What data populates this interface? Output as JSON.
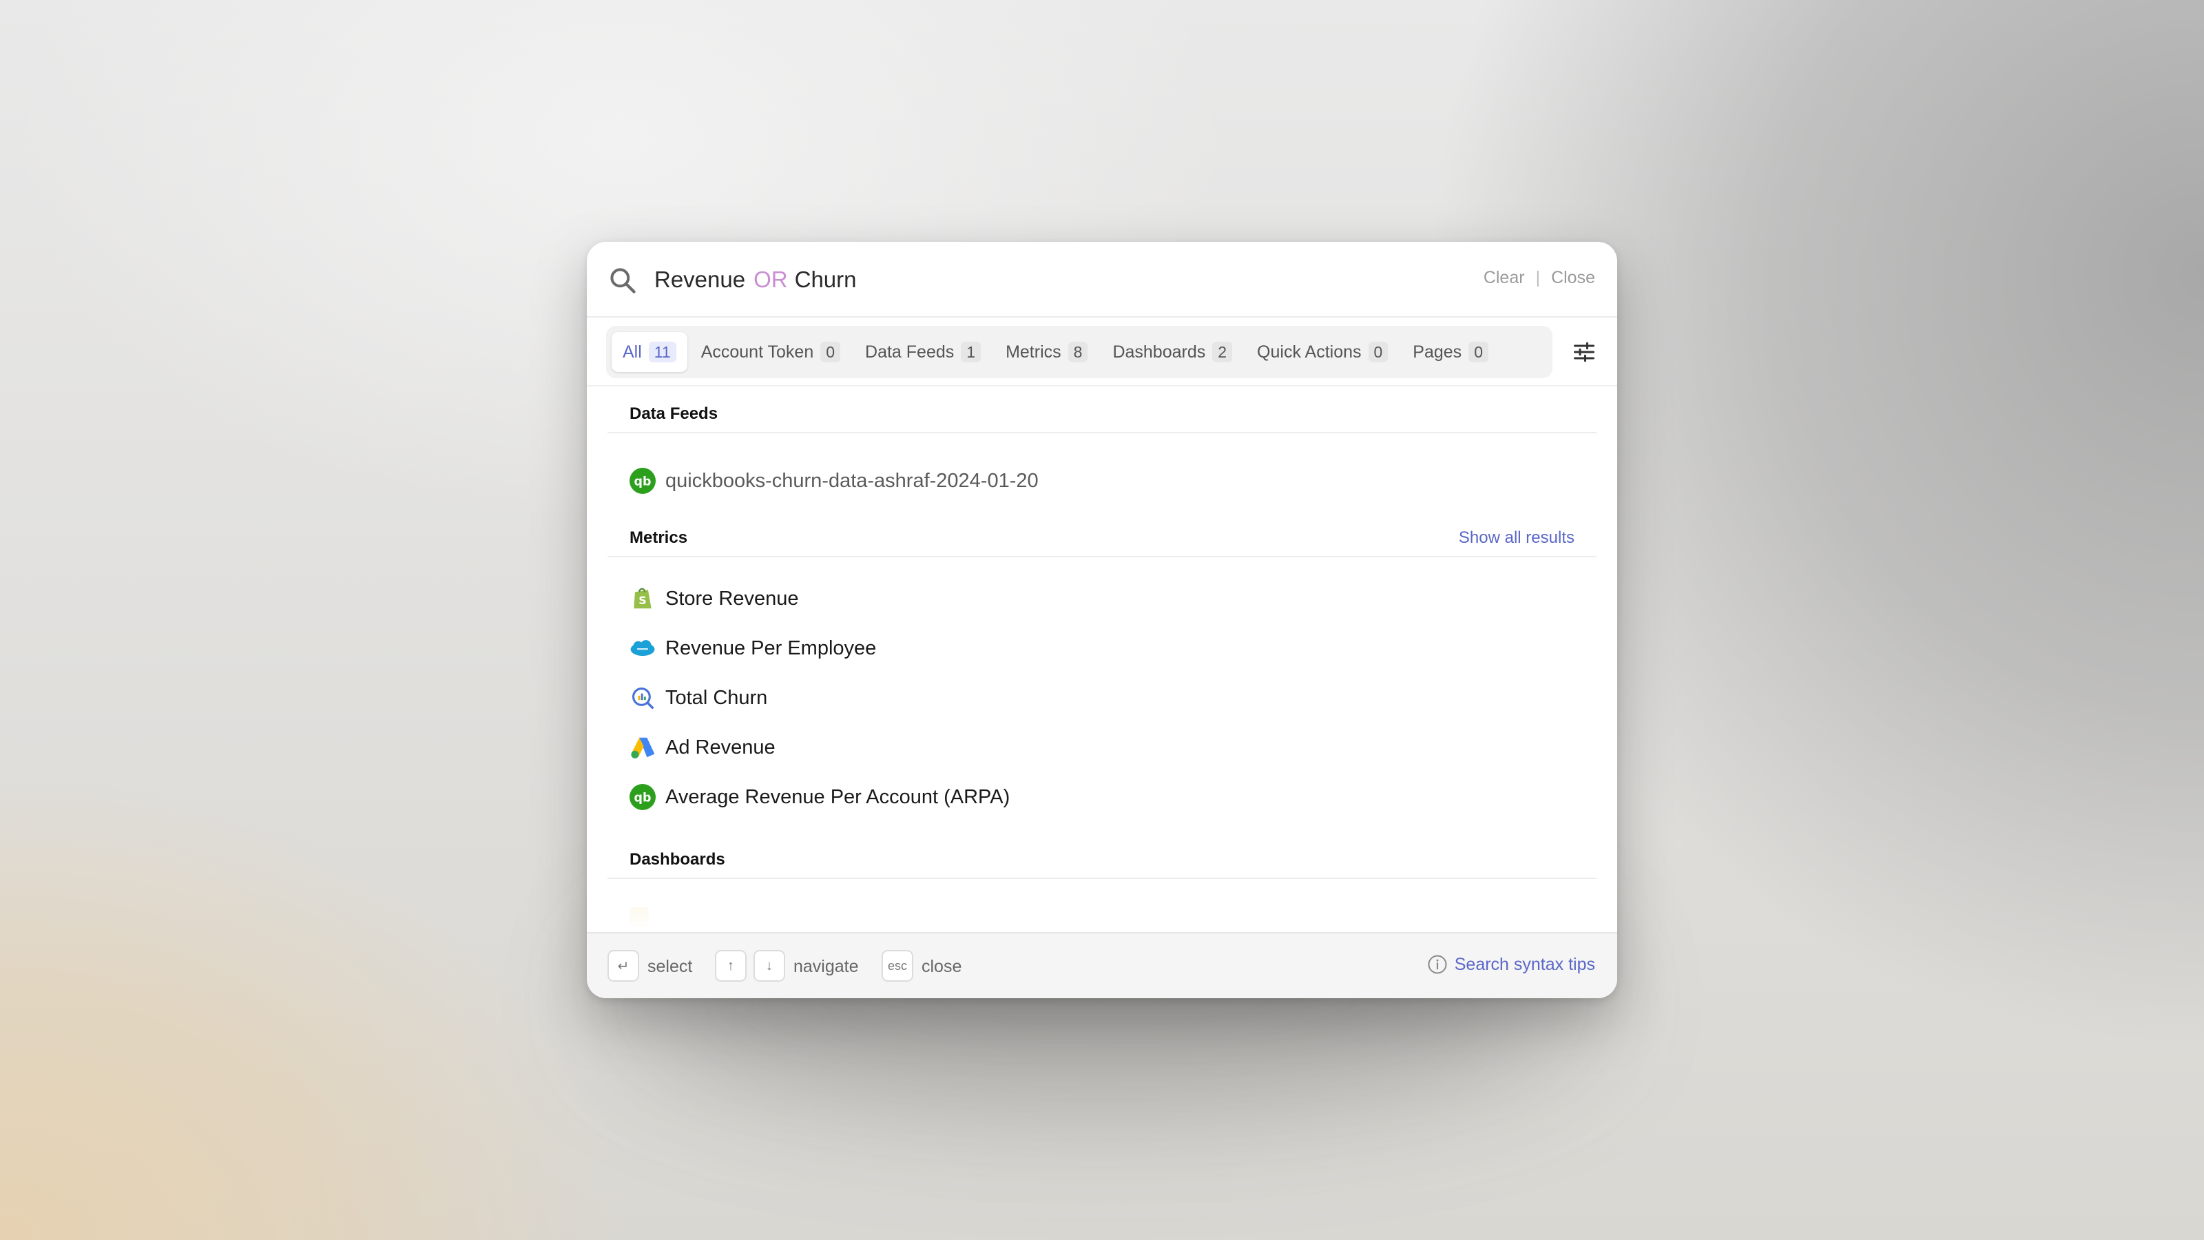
{
  "search": {
    "term1": "Revenue",
    "operator": "OR",
    "term2": "Churn",
    "clear_label": "Clear",
    "close_label": "Close"
  },
  "tabs": [
    {
      "label": "All",
      "count": "11",
      "active": true
    },
    {
      "label": "Account Token",
      "count": "0"
    },
    {
      "label": "Data Feeds",
      "count": "1"
    },
    {
      "label": "Metrics",
      "count": "8"
    },
    {
      "label": "Dashboards",
      "count": "2"
    },
    {
      "label": "Quick Actions",
      "count": "0"
    },
    {
      "label": "Pages",
      "count": "0"
    }
  ],
  "sections": {
    "data_feeds": {
      "title": "Data Feeds",
      "items": [
        {
          "label": "quickbooks-churn-data-ashraf-2024-01-20",
          "icon": "quickbooks-icon"
        }
      ]
    },
    "metrics": {
      "title": "Metrics",
      "show_all_label": "Show all results",
      "items": [
        {
          "label": "Store Revenue",
          "icon": "shopify-icon"
        },
        {
          "label": "Revenue Per Employee",
          "icon": "salesforce-icon"
        },
        {
          "label": "Total Churn",
          "icon": "analytics-search-icon"
        },
        {
          "label": "Ad Revenue",
          "icon": "google-ads-icon"
        },
        {
          "label": "Average Revenue Per Account (ARPA)",
          "icon": "quickbooks-icon"
        }
      ]
    },
    "dashboards": {
      "title": "Dashboards"
    }
  },
  "footer": {
    "select_key": "↵",
    "select_label": "select",
    "up_key": "↑",
    "down_key": "↓",
    "navigate_label": "navigate",
    "esc_key": "esc",
    "close_label": "close",
    "tips_label": "Search syntax tips"
  },
  "colors": {
    "accent": "#5a67c8",
    "operator": "#c98fd2",
    "quickbooks": "#2ca01c",
    "shopify": "#95bf47",
    "salesforce": "#1ba0d7"
  }
}
